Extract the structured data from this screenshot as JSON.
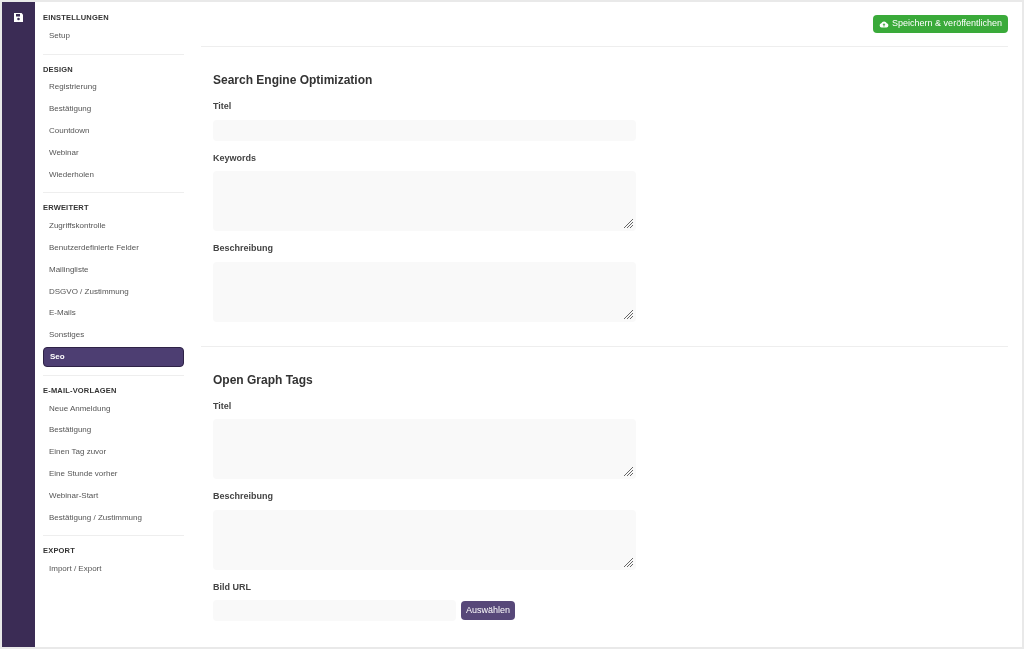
{
  "sidebar": {
    "groups": [
      {
        "heading": "EINSTELLUNGEN",
        "items": [
          {
            "label": "Setup",
            "selected": false
          }
        ]
      },
      {
        "heading": "DESIGN",
        "items": [
          {
            "label": "Registrierung",
            "selected": false
          },
          {
            "label": "Bestätigung",
            "selected": false
          },
          {
            "label": "Countdown",
            "selected": false
          },
          {
            "label": "Webinar",
            "selected": false
          },
          {
            "label": "Wiederholen",
            "selected": false
          }
        ]
      },
      {
        "heading": "ERWEITERT",
        "items": [
          {
            "label": "Zugriffskontrolle",
            "selected": false
          },
          {
            "label": "Benutzerdefinierte Felder",
            "selected": false
          },
          {
            "label": "Mailingliste",
            "selected": false
          },
          {
            "label": "DSGVO / Zustimmung",
            "selected": false
          },
          {
            "label": "E-Mails",
            "selected": false
          },
          {
            "label": "Sonstiges",
            "selected": false
          },
          {
            "label": "Seo",
            "selected": true
          }
        ]
      },
      {
        "heading": "E-MAIL-VORLAGEN",
        "items": [
          {
            "label": "Neue Anmeldung",
            "selected": false
          },
          {
            "label": "Bestätigung",
            "selected": false
          },
          {
            "label": "Einen Tag zuvor",
            "selected": false
          },
          {
            "label": "Eine Stunde vorher",
            "selected": false
          },
          {
            "label": "Webinar-Start",
            "selected": false
          },
          {
            "label": "Bestätigung / Zustimmung",
            "selected": false
          }
        ]
      },
      {
        "heading": "EXPORT",
        "items": [
          {
            "label": "Import / Export",
            "selected": false
          }
        ]
      }
    ]
  },
  "save_button": "Speichern & veröffentlichen",
  "sections": [
    {
      "title": "Search Engine Optimization",
      "fields": [
        {
          "kind": "input",
          "label": "Titel"
        },
        {
          "kind": "textarea",
          "label": "Keywords"
        },
        {
          "kind": "textarea",
          "label": "Beschreibung"
        }
      ]
    },
    {
      "title": "Open Graph Tags",
      "fields": [
        {
          "kind": "textarea",
          "label": "Titel"
        },
        {
          "kind": "textarea",
          "label": "Beschreibung"
        },
        {
          "kind": "picker",
          "label": "Bild URL",
          "button": "Auswählen"
        }
      ]
    }
  ]
}
